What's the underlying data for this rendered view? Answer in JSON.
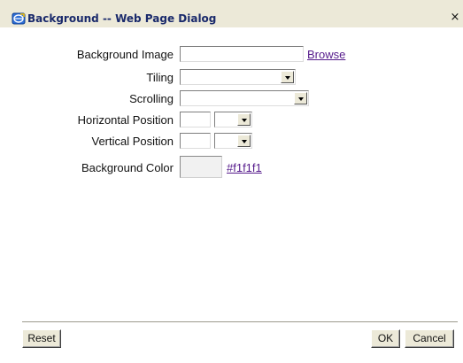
{
  "window": {
    "title": "Background -- Web Page Dialog",
    "close_label": "×"
  },
  "form": {
    "background_image": {
      "label": "Background Image",
      "value": "",
      "browse_label": "Browse"
    },
    "tiling": {
      "label": "Tiling",
      "selected": ""
    },
    "scrolling": {
      "label": "Scrolling",
      "selected": ""
    },
    "horizontal_position": {
      "label": "Horizontal Position",
      "value": "",
      "unit_selected": ""
    },
    "vertical_position": {
      "label": "Vertical Position",
      "value": "",
      "unit_selected": ""
    },
    "background_color": {
      "label": "Background Color",
      "swatch_color": "#f1f1f1",
      "value_link": "#f1f1f1"
    }
  },
  "buttons": {
    "reset": "Reset",
    "ok": "OK",
    "cancel": "Cancel"
  },
  "colors": {
    "dialog_chrome": "#ece9d8",
    "content_bg": "#ffffff",
    "link": "#551a8b",
    "title_text": "#1a2a6b"
  },
  "icons": {
    "title": "web-page-dialog-icon",
    "dropdown": "chevron-down-icon"
  }
}
